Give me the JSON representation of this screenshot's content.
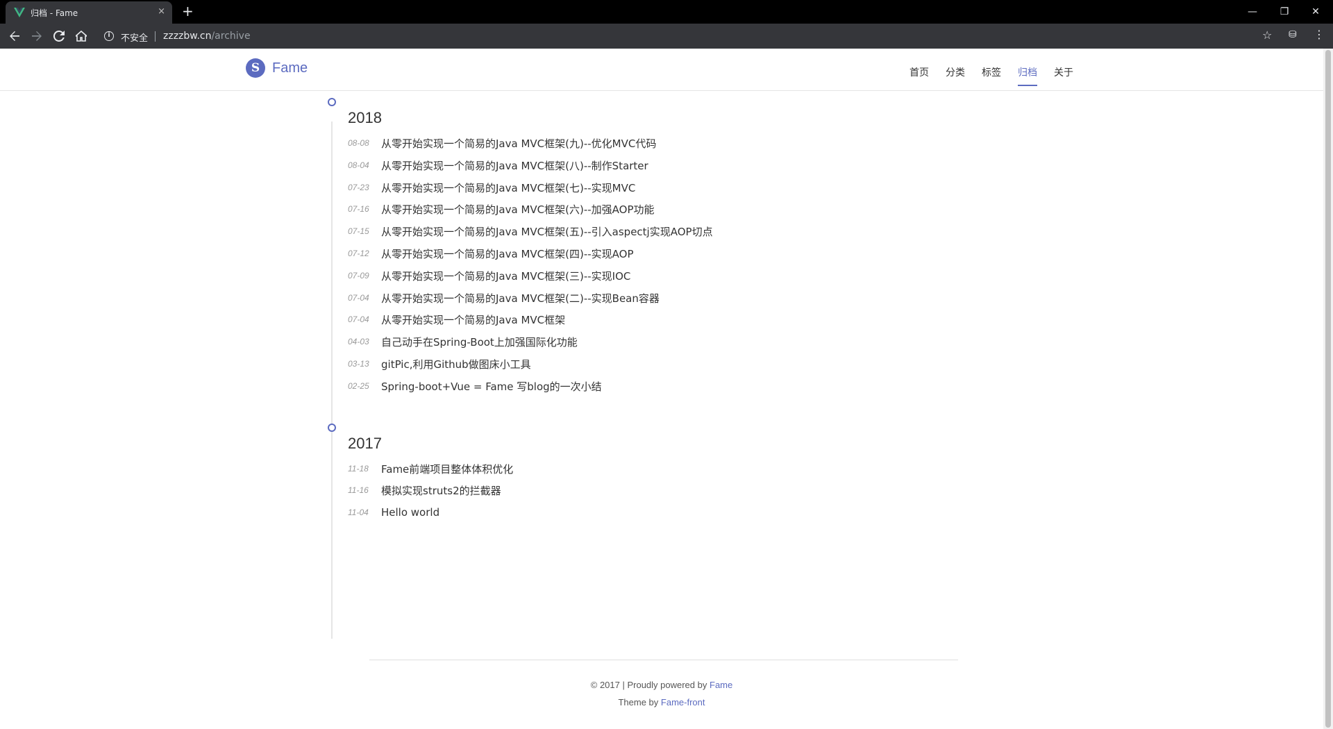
{
  "browser": {
    "tab_title": "归档 - Fame",
    "tab_close": "×",
    "new_tab": "+",
    "window_buttons": {
      "minimize": "—",
      "restore": "❐",
      "close": "✕"
    },
    "security_label": "不安全",
    "url_host": "zzzzbw.cn",
    "url_path": "/archive",
    "accent": "#5c6bc0"
  },
  "site": {
    "logo_mark": "S",
    "brand": "Fame",
    "nav": [
      {
        "label": "首页"
      },
      {
        "label": "分类"
      },
      {
        "label": "标签"
      },
      {
        "label": "归档",
        "active": true
      },
      {
        "label": "关于"
      }
    ]
  },
  "archive": [
    {
      "year": "2018",
      "posts": [
        {
          "date": "08-08",
          "title": "从零开始实现一个简易的Java MVC框架(九)--优化MVC代码"
        },
        {
          "date": "08-04",
          "title": "从零开始实现一个简易的Java MVC框架(八)--制作Starter"
        },
        {
          "date": "07-23",
          "title": "从零开始实现一个简易的Java MVC框架(七)--实现MVC"
        },
        {
          "date": "07-16",
          "title": "从零开始实现一个简易的Java MVC框架(六)--加强AOP功能"
        },
        {
          "date": "07-15",
          "title": "从零开始实现一个简易的Java MVC框架(五)--引入aspectj实现AOP切点"
        },
        {
          "date": "07-12",
          "title": "从零开始实现一个简易的Java MVC框架(四)--实现AOP"
        },
        {
          "date": "07-09",
          "title": "从零开始实现一个简易的Java MVC框架(三)--实现IOC"
        },
        {
          "date": "07-04",
          "title": "从零开始实现一个简易的Java MVC框架(二)--实现Bean容器"
        },
        {
          "date": "07-04",
          "title": "从零开始实现一个简易的Java MVC框架"
        },
        {
          "date": "04-03",
          "title": "自己动手在Spring-Boot上加强国际化功能"
        },
        {
          "date": "03-13",
          "title": "gitPic,利用Github做图床小工具"
        },
        {
          "date": "02-25",
          "title": "Spring-boot+Vue = Fame 写blog的一次小结"
        }
      ]
    },
    {
      "year": "2017",
      "posts": [
        {
          "date": "11-18",
          "title": "Fame前端项目整体体积优化"
        },
        {
          "date": "11-16",
          "title": "模拟实现struts2的拦截器"
        },
        {
          "date": "11-04",
          "title": "Hello world"
        }
      ]
    }
  ],
  "footer": {
    "copyright": "© 2017 | Proudly powered by",
    "powered_link": "Fame",
    "theme_prefix": "Theme by",
    "theme_link": "Fame-front"
  }
}
